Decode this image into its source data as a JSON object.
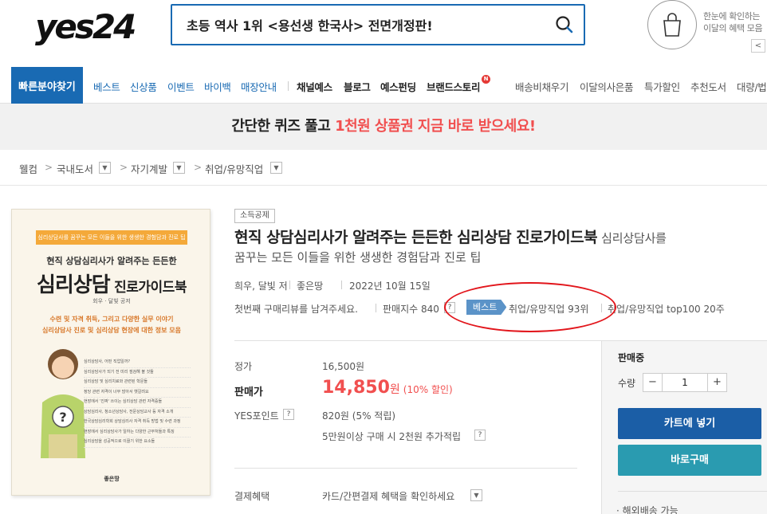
{
  "header": {
    "logo_text": "yes24",
    "search_query": "초등 역사 1위 <용선생 한국사> 전면개정판!",
    "promo_line1": "한눈에 확인하는",
    "promo_line2": "이달의 혜택 모음",
    "promo_arrow": "<"
  },
  "nav": {
    "quick": "빠른분야찾기",
    "items_blue": [
      "베스트",
      "신상품",
      "이벤트",
      "바이백",
      "매장안내"
    ],
    "items_dark": [
      "채널예스",
      "블로그",
      "예스펀딩",
      "브랜드스토리"
    ],
    "items_right": [
      "배송비채우기",
      "이달의사은품",
      "특가할인",
      "추천도서",
      "대량/법"
    ],
    "new_badge": "N"
  },
  "banner": {
    "text_plain": "간단한 퀴즈 풀고 ",
    "text_highlight": "1천원 상품권 지금 바로 받으세요!"
  },
  "breadcrumb": {
    "items": [
      "웰컴",
      "국내도서",
      "자기계발",
      "취업/유망직업"
    ]
  },
  "cover": {
    "bar": "심리상담사를 꿈꾸는 모든 이들을 위한 생생한 경험담과 진로 팁",
    "subtitle": "현직 상담심리사가 알려주는 든든한",
    "title_big": "심리상담",
    "title_small": " 진로가이드북",
    "author": "회우 · 달빛 공저",
    "tag1": "수련 및 자격 취득, 그리고 다양한 실무 이야기",
    "tag2": "심리상담사 진로 및 심리상담 현장에 대한 정보 모음",
    "list": [
      "심리상담사, 어떤 직업일까?",
      "심리상담사가 되기 전 미리 점검해 볼 것들",
      "심리상담 및 심리치료와 관련된 학문들",
      "정당 관련 자격이 너무 많아서 헷갈려요",
      "현장에서 '진짜' 쓰이는 심리상담 관련 자격증들",
      "상담심리사, 청소년상담사, 전문상담교사 등 자격 소개",
      "한국상담심리학회 상담심리사 자격 취득 방법 및 수련 과정",
      "현장에서 심리상담사가 일하는 다양한 근무처들과 특징",
      "심리상담을 성공적으로 이끌기 위한 요소들"
    ],
    "publisher": "좋은땅"
  },
  "product": {
    "badge": "소득공제",
    "title": "현직 상담심리사가 알려주는 든든한 심리상담 진로가이드북",
    "subtitle_part1": "심리상담사를",
    "subtitle_part2": "꿈꾸는 모든 이들을 위한 생생한 경험담과 진로 팁",
    "author": "희우, 달빛 저",
    "publisher": "좋은땅",
    "date": "2022년 10월 15일",
    "review_prompt": "첫번째 구매리뷰를 남겨주세요.",
    "sales_index": "판매지수 840",
    "qmark": "?",
    "best_tag": "베스트",
    "rank1": "취업/유망직업 93위",
    "rank2": "취업/유망직업 top100 20주"
  },
  "price": {
    "list_label": "정가",
    "list_value": "16,500원",
    "sale_label": "판매가",
    "sale_value": "14,850",
    "sale_unit": "원",
    "sale_discount": "(10% 할인)",
    "point_label": "YES포인트",
    "point_value": "820원 (5% 적립)",
    "point_extra": "5만원이상 구매 시 2천원 추가적립",
    "benefit_label": "결제혜택",
    "benefit_value": "카드/간편결제 혜택을 확인하세요"
  },
  "buy": {
    "status": "판매중",
    "qty_label": "수량",
    "qty_value": "1",
    "minus": "−",
    "plus": "+",
    "cart_button": "카트에 넣기",
    "buy_button": "바로구매",
    "note": "· 해외배송 가능"
  },
  "colors": {
    "brand_blue": "#196ab3",
    "sale_red": "#f14f4f",
    "annotation_red": "#e2161c",
    "buy_teal": "#2a9bb0"
  }
}
